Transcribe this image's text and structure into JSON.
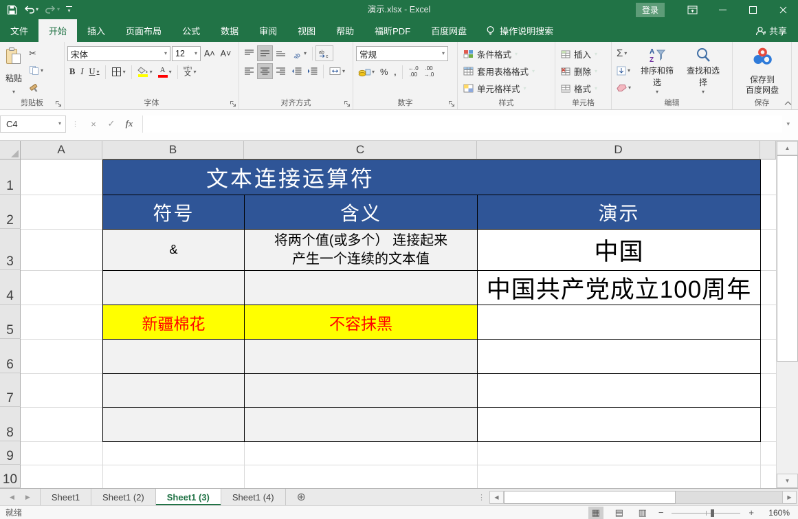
{
  "window": {
    "title": "演示.xlsx  -  Excel",
    "login_button": "登录",
    "share_button": "共享"
  },
  "tell_me": "操作说明搜索",
  "ribbon_tabs": [
    {
      "id": "file",
      "label": "文件",
      "active": false
    },
    {
      "id": "home",
      "label": "开始",
      "active": true
    },
    {
      "id": "insert",
      "label": "插入",
      "active": false
    },
    {
      "id": "page-layout",
      "label": "页面布局",
      "active": false
    },
    {
      "id": "formulas",
      "label": "公式",
      "active": false
    },
    {
      "id": "data",
      "label": "数据",
      "active": false
    },
    {
      "id": "review",
      "label": "审阅",
      "active": false
    },
    {
      "id": "view",
      "label": "视图",
      "active": false
    },
    {
      "id": "help",
      "label": "帮助",
      "active": false
    },
    {
      "id": "foxit-pdf",
      "label": "福昕PDF",
      "active": false
    },
    {
      "id": "baidu-netdisk",
      "label": "百度网盘",
      "active": false
    }
  ],
  "ribbon": {
    "clipboard": {
      "label": "剪贴板",
      "paste": "粘贴"
    },
    "font": {
      "label": "字体",
      "name": "宋体",
      "size": "12",
      "phonetic_top": "wén",
      "phonetic_bottom": "文"
    },
    "alignment": {
      "label": "对齐方式"
    },
    "number": {
      "label": "数字",
      "format": "常规"
    },
    "styles": {
      "label": "样式",
      "conditional": "条件格式",
      "table_format": "套用表格格式",
      "cell_styles": "单元格样式"
    },
    "cells": {
      "label": "单元格",
      "insert": "插入",
      "delete": "删除",
      "format": "格式"
    },
    "editing": {
      "label": "编辑",
      "sort_filter": "排序和筛选",
      "find_select": "查找和选择"
    },
    "save": {
      "label": "保存",
      "line1": "保存到",
      "line2": "百度网盘"
    }
  },
  "formula_bar": {
    "name_box": "C4",
    "fx_label": "fx",
    "value": ""
  },
  "sheet": {
    "column_headers": [
      "A",
      "B",
      "C",
      "D"
    ],
    "row_headers": [
      "1",
      "2",
      "3",
      "4",
      "5",
      "6",
      "7",
      "8",
      "9",
      "10"
    ],
    "table": {
      "title": "文本连接运算符",
      "headers": {
        "symbol": "符号",
        "meaning": "含义",
        "demo": "演示"
      },
      "rows": [
        {
          "b": "&",
          "c": "将两个值(或多个） 连接起来\n产生一个连续的文本值",
          "d": "中国",
          "highlight": false
        },
        {
          "b": "",
          "c": "",
          "d": "中国共产党成立100周年",
          "highlight": false
        },
        {
          "b": "新疆棉花",
          "c": "不容抹黑",
          "d": "",
          "highlight": true
        },
        {
          "b": "",
          "c": "",
          "d": "",
          "highlight": false
        },
        {
          "b": "",
          "c": "",
          "d": "",
          "highlight": false
        },
        {
          "b": "",
          "c": "",
          "d": "",
          "highlight": false
        }
      ]
    },
    "colors": {
      "header_blue": "#2F5597",
      "highlight_yellow": "#FFFF00",
      "highlight_red": "#FF0000",
      "row_gray": "#F2F2F2",
      "excel_green": "#217346"
    }
  },
  "sheet_tabs": {
    "tabs": [
      {
        "id": "sheet1",
        "label": "Sheet1",
        "active": false
      },
      {
        "id": "sheet1-2",
        "label": "Sheet1 (2)",
        "active": false
      },
      {
        "id": "sheet1-3",
        "label": "Sheet1 (3)",
        "active": true
      },
      {
        "id": "sheet1-4",
        "label": "Sheet1 (4)",
        "active": false
      }
    ]
  },
  "status_bar": {
    "mode": "就绪",
    "zoom_level": "160%"
  },
  "icons": {
    "dropdown": "▾",
    "scissors": "✂",
    "sigma": "Σ",
    "percent": "%",
    "comma": ",",
    "check": "✓",
    "cancel": "×",
    "up": "▲",
    "down": "▼",
    "left": "◀",
    "right": "▶",
    "new_sheet": "⊕",
    "dots": "⋮",
    "bold": "B",
    "italic": "I",
    "underline": "U",
    "inc_dec_top": "←.0",
    "inc_dec_bottom": ".00",
    "dec_dec_top": ".00",
    "dec_dec_bottom": "→.0",
    "view_normal": "▦",
    "view_layout": "▤",
    "view_break": "▥",
    "zoom_out": "−",
    "zoom_in": "+",
    "font_grow": "A˄",
    "font_shrink": "A˅"
  }
}
